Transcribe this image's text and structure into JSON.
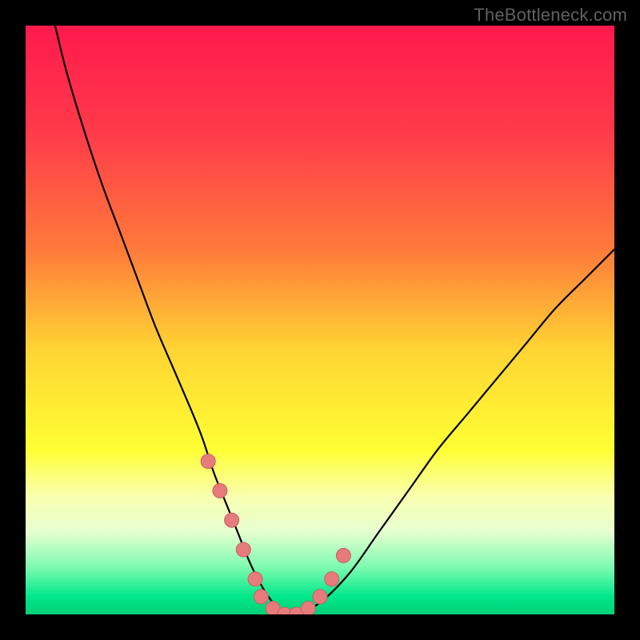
{
  "watermark": "TheBottleneck.com",
  "colors": {
    "frame": "#000000",
    "gradient_stops": [
      {
        "offset": 0.0,
        "color": "#ff1a4d"
      },
      {
        "offset": 0.18,
        "color": "#ff3a4a"
      },
      {
        "offset": 0.38,
        "color": "#ff7a3a"
      },
      {
        "offset": 0.55,
        "color": "#ffd433"
      },
      {
        "offset": 0.72,
        "color": "#ffff33"
      },
      {
        "offset": 0.8,
        "color": "#f9ffb0"
      },
      {
        "offset": 0.86,
        "color": "#e6ffd0"
      },
      {
        "offset": 0.92,
        "color": "#7dfbb0"
      },
      {
        "offset": 0.97,
        "color": "#00e789"
      },
      {
        "offset": 1.0,
        "color": "#00d178"
      }
    ],
    "curve": "#000000",
    "marker_fill": "#e77b7b",
    "marker_stroke": "#c95f5f"
  },
  "chart_data": {
    "type": "line",
    "title": "",
    "xlabel": "",
    "ylabel": "",
    "xlim": [
      0,
      100
    ],
    "ylim": [
      0,
      100
    ],
    "grid": false,
    "legend": false,
    "series": [
      {
        "name": "bottleneck-curve",
        "x": [
          5,
          7,
          10,
          13,
          16,
          19,
          22,
          25,
          28,
          30,
          32,
          34,
          36,
          38,
          40,
          42,
          44,
          46,
          50,
          55,
          60,
          65,
          70,
          75,
          80,
          85,
          90,
          95,
          100
        ],
        "y": [
          100,
          92,
          82,
          73,
          65,
          57,
          49,
          42,
          35,
          30,
          24,
          19,
          14,
          9,
          5,
          2,
          0,
          0,
          2,
          7,
          14,
          21,
          28,
          34,
          40,
          46,
          52,
          57,
          62
        ]
      }
    ],
    "markers": {
      "name": "highlight-points",
      "x": [
        31,
        33,
        35,
        37,
        39,
        40,
        42,
        44,
        46,
        48,
        50,
        52,
        54
      ],
      "y": [
        26,
        21,
        16,
        11,
        6,
        3,
        1,
        0,
        0,
        1,
        3,
        6,
        10
      ]
    }
  }
}
